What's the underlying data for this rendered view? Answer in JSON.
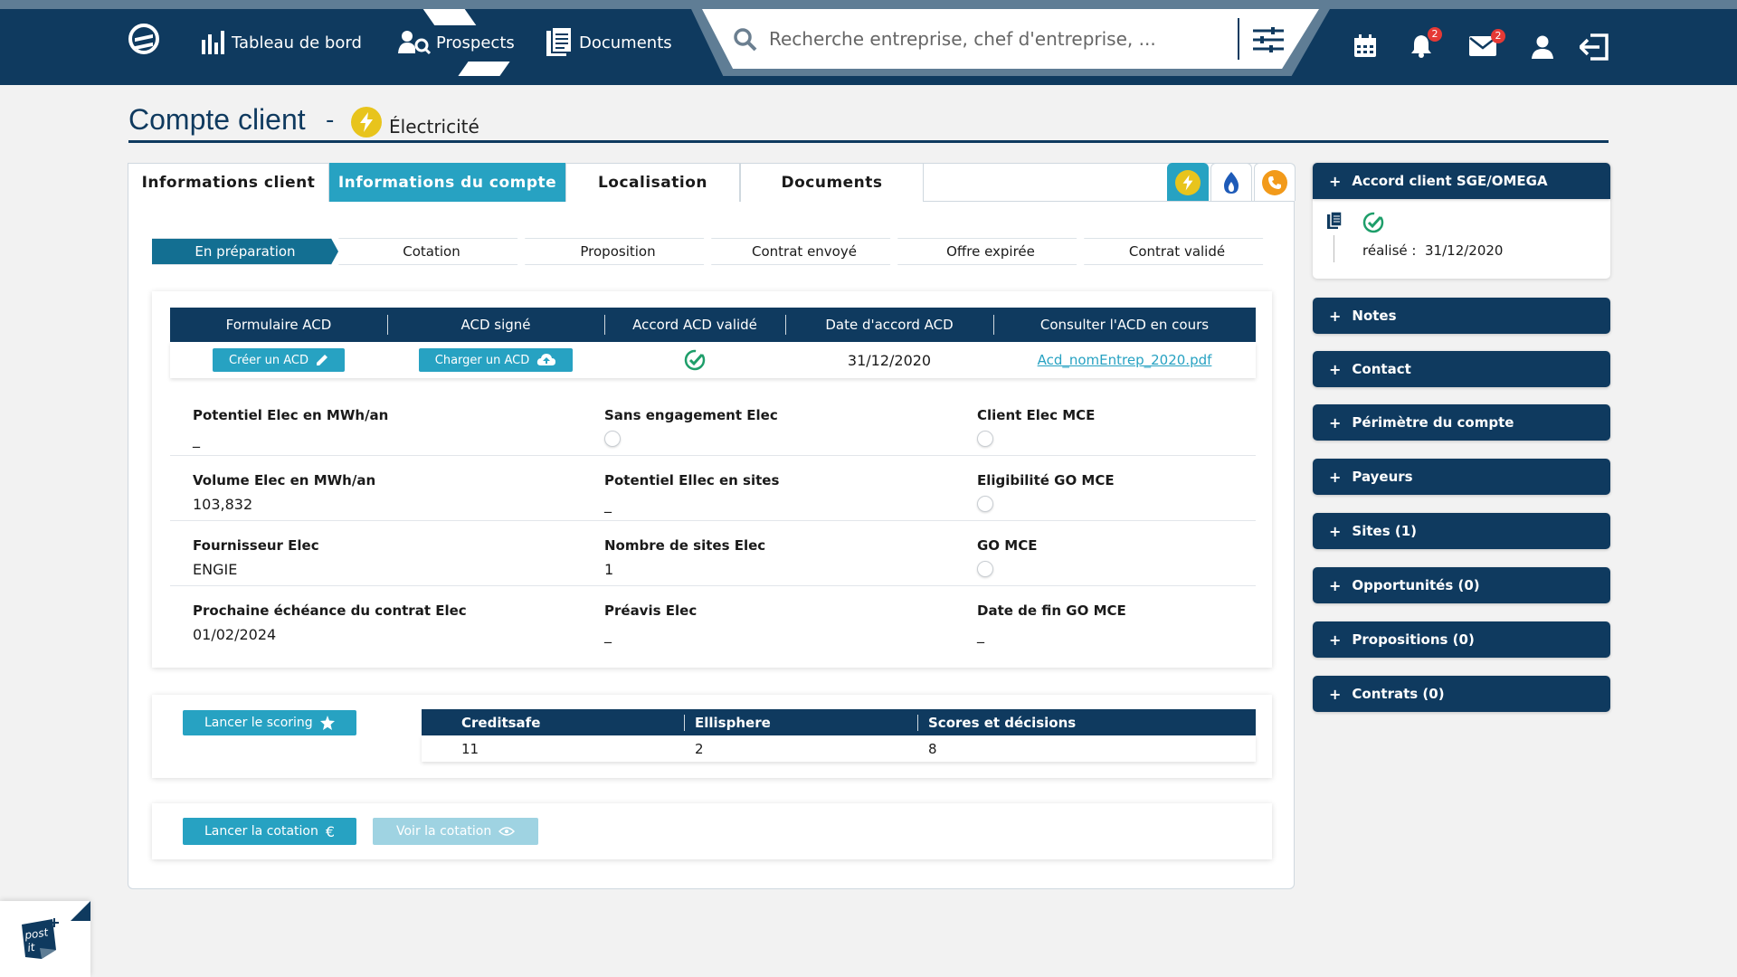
{
  "nav": {
    "dashboard": "Tableau de bord",
    "prospects": "Prospects",
    "documents": "Documents",
    "search_placeholder": "Recherche entreprise, chef d'entreprise, ...",
    "notifications_count": "2",
    "messages_count": "2"
  },
  "header": {
    "title": "Compte client",
    "dash": "-",
    "energy": "Électricité"
  },
  "tabs": [
    "Informations client",
    "Informations du compte",
    "Localisation",
    "Documents"
  ],
  "active_tab": "Informations du compte",
  "steps": [
    "En préparation",
    "Cotation",
    "Proposition",
    "Contrat envoyé",
    "Offre expirée",
    "Contrat validé"
  ],
  "active_step": "En préparation",
  "acd": {
    "headers": [
      "Formulaire ACD",
      "ACD signé",
      "Accord ACD validé",
      "Date d'accord ACD",
      "Consulter l'ACD en cours"
    ],
    "create_button": "Créer un ACD",
    "upload_button": "Charger un ACD",
    "date": "31/12/2020",
    "file_link": "Acd_nomEntrep_2020.pdf"
  },
  "fields": {
    "potentiel_label": "Potentiel Elec en MWh/an",
    "potentiel_value": "_",
    "sans_engagement_label": "Sans engagement Elec",
    "client_mce_label": "Client Elec MCE",
    "volume_label": "Volume Elec en MWh/an",
    "volume_value": "103,832",
    "potentiel_sites_label": "Potentiel Ellec en sites",
    "potentiel_sites_value": "_",
    "eligibilite_label": "Eligibilité GO MCE",
    "fournisseur_label": "Fournisseur Elec",
    "fournisseur_value": "ENGIE",
    "nb_sites_label": "Nombre de sites Elec",
    "nb_sites_value": "1",
    "go_mce_label": "GO MCE",
    "echeance_label": "Prochaine échéance du contrat Elec",
    "echeance_value": "01/02/2024",
    "preavis_label": "Préavis Elec",
    "preavis_value": "_",
    "fin_go_label": "Date de fin GO MCE",
    "fin_go_value": "_"
  },
  "scoring": {
    "button": "Lancer le scoring",
    "headers": [
      "Creditsafe",
      "Ellisphere",
      "Scores et décisions"
    ],
    "values": [
      "11",
      "2",
      "8"
    ]
  },
  "cotation": {
    "launch_button": "Lancer la cotation",
    "view_button": "Voir la cotation"
  },
  "right_panel": {
    "accord_title": "Accord client SGE/OMEGA",
    "accord_label": "réalisé :",
    "accord_date": "31/12/2020",
    "sections": [
      "Notes",
      "Contact",
      "Périmètre du compte",
      "Payeurs",
      "Sites (1)",
      "Opportunités (0)",
      "Propositions (0)",
      "Contrats (0)"
    ]
  },
  "postit": {
    "line1": "post",
    "line2": "it"
  },
  "colors": {
    "navy": "#0f3a5f",
    "teal": "#27a2c2",
    "step_active": "#136f92",
    "elec_yellow": "#e8c41c",
    "check_green": "#1e9e6a",
    "badge_red": "#e53935"
  }
}
